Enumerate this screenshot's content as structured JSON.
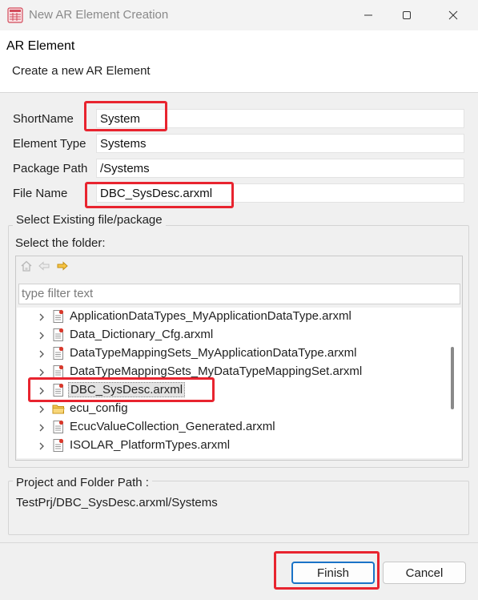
{
  "window": {
    "title": "New AR Element Creation",
    "controls": {
      "minimize": "minimize-icon",
      "maximize": "maximize-icon",
      "close": "close-icon"
    }
  },
  "header": {
    "title": "AR Element",
    "subtitle": "Create a new AR Element"
  },
  "form": {
    "short_name": {
      "label": "ShortName",
      "value": "System"
    },
    "element_type": {
      "label": "Element Type",
      "value": "Systems"
    },
    "package_path": {
      "label": "Package Path",
      "value": "/Systems"
    },
    "file_name": {
      "label": "File Name",
      "value": "DBC_SysDesc.arxml"
    }
  },
  "existing_group": {
    "legend": "Select Existing file/package",
    "folder_label": "Select the folder:",
    "filter_placeholder": "type filter text",
    "nav_icons": [
      "home-icon",
      "back-icon",
      "forward-icon"
    ],
    "tree_items": [
      {
        "label": "ApplicationDataTypes_MyApplicationDataType.arxml",
        "icon": "arxml-file-icon",
        "selected": false
      },
      {
        "label": "Data_Dictionary_Cfg.arxml",
        "icon": "arxml-file-icon",
        "selected": false
      },
      {
        "label": "DataTypeMappingSets_MyApplicationDataType.arxml",
        "icon": "arxml-file-icon",
        "selected": false
      },
      {
        "label": "DataTypeMappingSets_MyDataTypeMappingSet.arxml",
        "icon": "arxml-file-icon",
        "selected": false
      },
      {
        "label": "DBC_SysDesc.arxml",
        "icon": "arxml-file-icon",
        "selected": true
      },
      {
        "label": "ecu_config",
        "icon": "folder-icon",
        "selected": false
      },
      {
        "label": "EcucValueCollection_Generated.arxml",
        "icon": "arxml-file-icon",
        "selected": false
      },
      {
        "label": "ISOLAR_PlatformTypes.arxml",
        "icon": "arxml-file-icon",
        "selected": false
      }
    ]
  },
  "path_group": {
    "legend": "Project and Folder Path :",
    "value": "TestPrj/DBC_SysDesc.arxml/Systems"
  },
  "buttons": {
    "finish": "Finish",
    "cancel": "Cancel"
  },
  "colors": {
    "highlight_red": "#e8242f",
    "default_button_border": "#1a73c7",
    "file_icon_red": "#d9382b",
    "folder_yellow": "#e0a526"
  }
}
